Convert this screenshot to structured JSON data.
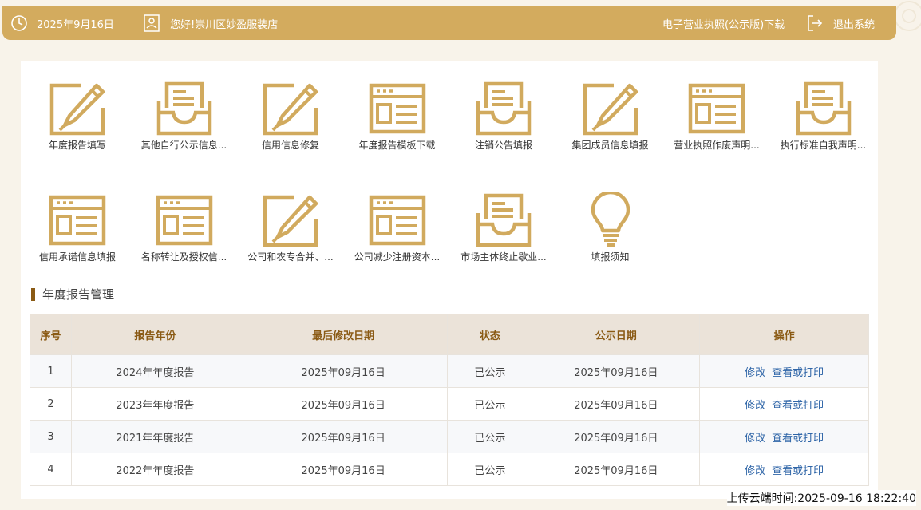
{
  "header": {
    "date": "2025年9月16日",
    "greeting": "您好!崇川区妙盈服装店",
    "license_download": "电子营业执照(公示版)下载",
    "logout": "退出系统"
  },
  "tiles": [
    {
      "label": "年度报告填写",
      "icon": "edit-icon"
    },
    {
      "label": "其他自行公示信息...",
      "icon": "inbox-icon"
    },
    {
      "label": "信用信息修复",
      "icon": "edit-icon"
    },
    {
      "label": "年度报告模板下载",
      "icon": "window-icon"
    },
    {
      "label": "注销公告填报",
      "icon": "inbox-icon"
    },
    {
      "label": "集团成员信息填报",
      "icon": "edit-icon"
    },
    {
      "label": "营业执照作废声明...",
      "icon": "window-icon"
    },
    {
      "label": "执行标准自我声明...",
      "icon": "inbox-icon"
    },
    {
      "label": "信用承诺信息填报",
      "icon": "window-icon"
    },
    {
      "label": "名称转让及授权信...",
      "icon": "window-icon"
    },
    {
      "label": "公司和农专合并、...",
      "icon": "edit-icon"
    },
    {
      "label": "公司减少注册资本...",
      "icon": "window-icon"
    },
    {
      "label": "市场主体终止歇业...",
      "icon": "inbox-icon"
    },
    {
      "label": "填报须知",
      "icon": "lightbulb-icon"
    }
  ],
  "section": {
    "title": "年度报告管理"
  },
  "table": {
    "headers": [
      "序号",
      "报告年份",
      "最后修改日期",
      "状态",
      "公示日期",
      "操作"
    ],
    "rows": [
      {
        "no": "1",
        "year": "2024年年度报告",
        "modified": "2025年09月16日",
        "status": "已公示",
        "published": "2025年09月16日"
      },
      {
        "no": "2",
        "year": "2023年年度报告",
        "modified": "2025年09月16日",
        "status": "已公示",
        "published": "2025年09月16日"
      },
      {
        "no": "3",
        "year": "2021年年度报告",
        "modified": "2025年09月16日",
        "status": "已公示",
        "published": "2025年09月16日"
      },
      {
        "no": "4",
        "year": "2022年年度报告",
        "modified": "2025年09月16日",
        "status": "已公示",
        "published": "2025年09月16日"
      }
    ],
    "op_edit": "修改",
    "op_view": "查看或打印"
  },
  "upload_time": "上传云端时间:2025-09-16 18:22:40",
  "colors": {
    "accent": "#d3ab5e",
    "header_text": "#8a5a14",
    "link": "#3066a8"
  }
}
